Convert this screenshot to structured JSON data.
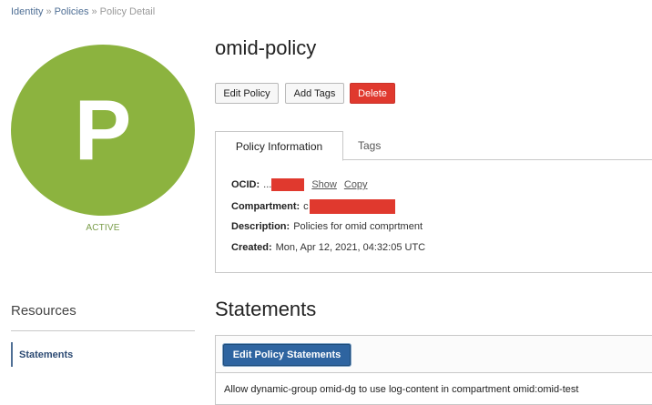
{
  "colors": {
    "avatar_bg": "#8cb33f",
    "status_green": "#7a9d4a",
    "danger": "#e0392e",
    "primary": "#2e64a0"
  },
  "breadcrumb": {
    "items": [
      "Identity",
      "Policies"
    ],
    "separator": "»",
    "current": "Policy Detail"
  },
  "avatar": {
    "letter": "P"
  },
  "status": "ACTIVE",
  "page_title": "omid-policy",
  "actions": {
    "edit": "Edit Policy",
    "add_tags": "Add Tags",
    "delete": "Delete"
  },
  "tabs": {
    "info": "Policy Information",
    "tags": "Tags"
  },
  "info": {
    "ocid_label": "OCID:",
    "ocid_value": "...",
    "show": "Show",
    "copy": "Copy",
    "compartment_label": "Compartment:",
    "compartment_value": "c",
    "description_label": "Description:",
    "description_value": "Policies for omid comprtment",
    "created_label": "Created:",
    "created_value": "Mon, Apr 12, 2021, 04:32:05 UTC"
  },
  "resources": {
    "title": "Resources",
    "items": [
      "Statements"
    ]
  },
  "statements": {
    "title": "Statements",
    "edit_button": "Edit Policy Statements",
    "rows": [
      "Allow dynamic-group omid-dg to use log-content in compartment omid:omid-test"
    ]
  }
}
